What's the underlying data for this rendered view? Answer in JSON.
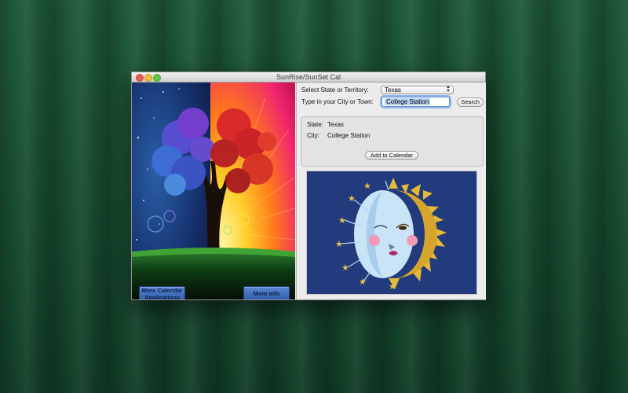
{
  "window": {
    "title": "SunRise/SunSet Cal"
  },
  "art_panel": {
    "more_calendar_label": "More Calendar Applications",
    "more_info_label": "More Info"
  },
  "form": {
    "state_label": "Select State or Territory:",
    "state_selected": "Texas",
    "city_label": "Type in your City or Town:",
    "city_value": "College Station",
    "search_label": "Search"
  },
  "result": {
    "state_key": "State:",
    "state_value": "Texas",
    "city_key": "City:",
    "city_value": "College Station",
    "add_label": "Add to Calendar"
  },
  "colors": {
    "accent": "#5b86d1",
    "sun_gold": "#d8a52c",
    "moon_blue": "#bfe0f5",
    "image_bg": "#213b7c"
  }
}
